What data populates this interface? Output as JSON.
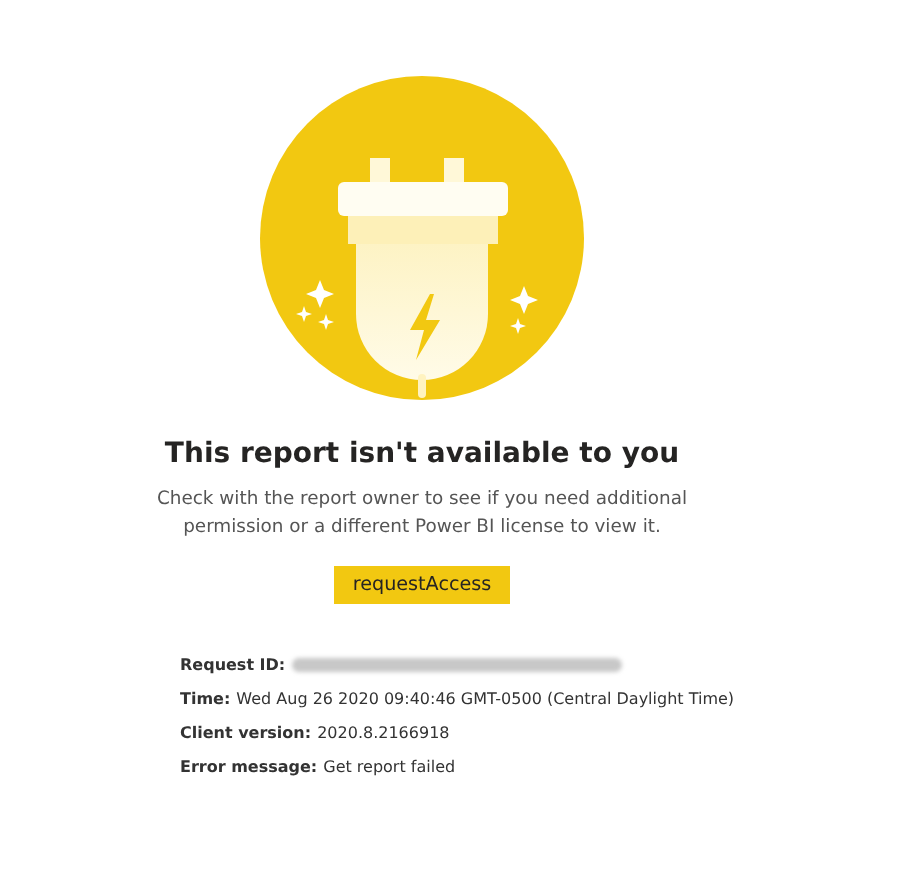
{
  "title": "This report isn't available to you",
  "message": "Check with the report owner to see if you need additional permission or a different Power BI license to view it.",
  "button": {
    "label": "requestAccess"
  },
  "details": [
    {
      "label": "Request ID:",
      "redacted": true
    },
    {
      "label": "Time:",
      "value": "Wed Aug 26 2020 09:40:46 GMT-0500 (Central Daylight Time)",
      "redacted": false
    },
    {
      "label": "Client version:",
      "value": "2020.8.2166918",
      "redacted": false
    },
    {
      "label": "Error message:",
      "value": "Get report failed",
      "redacted": false
    }
  ]
}
